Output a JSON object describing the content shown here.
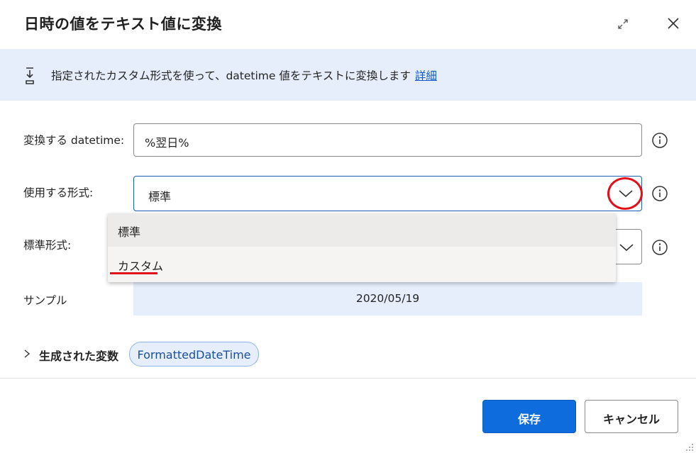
{
  "dialog": {
    "title": "日時の値をテキスト値に変換",
    "expand_icon": "expand-icon",
    "close_icon": "close-icon"
  },
  "banner": {
    "icon": "convert-icon",
    "text": "指定されたカスタム形式を使って、datetime 値をテキストに変換します",
    "link": "詳細"
  },
  "fields": {
    "datetime_label": "変換する datetime:",
    "datetime_value": "%翌日%",
    "format_label": "使用する形式:",
    "format_value": "標準",
    "standard_label": "標準形式:",
    "sample_label": "サンプル",
    "sample_value": "2020/05/19"
  },
  "dropdown": {
    "options": [
      "標準",
      "カスタム"
    ],
    "selected": "標準"
  },
  "variables": {
    "label": "生成された変数",
    "name": "FormattedDateTime"
  },
  "buttons": {
    "save": "保存",
    "cancel": "キャンセル"
  },
  "colors": {
    "primary": "#0f6cdc",
    "banner_bg": "#e6eefc",
    "highlight": "#e0101a",
    "link": "#0f5bc4"
  }
}
